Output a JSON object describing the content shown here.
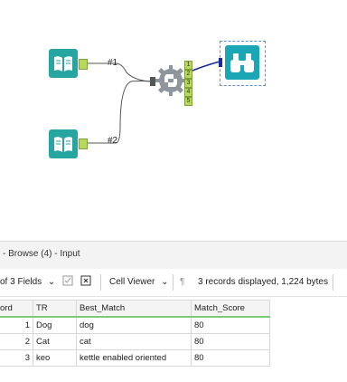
{
  "canvas": {
    "connection_labels": [
      "#1",
      "#2"
    ],
    "output_anchors": [
      "1",
      "2",
      "3",
      "4",
      "5"
    ],
    "colors": {
      "input_tool": "#27a5a0",
      "python_tool": "#8e959d",
      "browse_tool": "#1ba6b6",
      "anchor": "#b7d95b"
    }
  },
  "panel": {
    "title": "- Browse (4) - Input"
  },
  "toolbar": {
    "fields_label": "of 3 Fields",
    "cell_viewer_label": "Cell Viewer",
    "status": "3 records displayed, 1,224 bytes"
  },
  "grid": {
    "columns": [
      "ord",
      "TR",
      "Best_Match",
      "Match_Score"
    ],
    "rows": [
      [
        "1",
        "Dog",
        "dog",
        "80"
      ],
      [
        "2",
        "Cat",
        "cat",
        "80"
      ],
      [
        "3",
        "keo",
        "kettle enabled oriented",
        "80"
      ]
    ]
  }
}
